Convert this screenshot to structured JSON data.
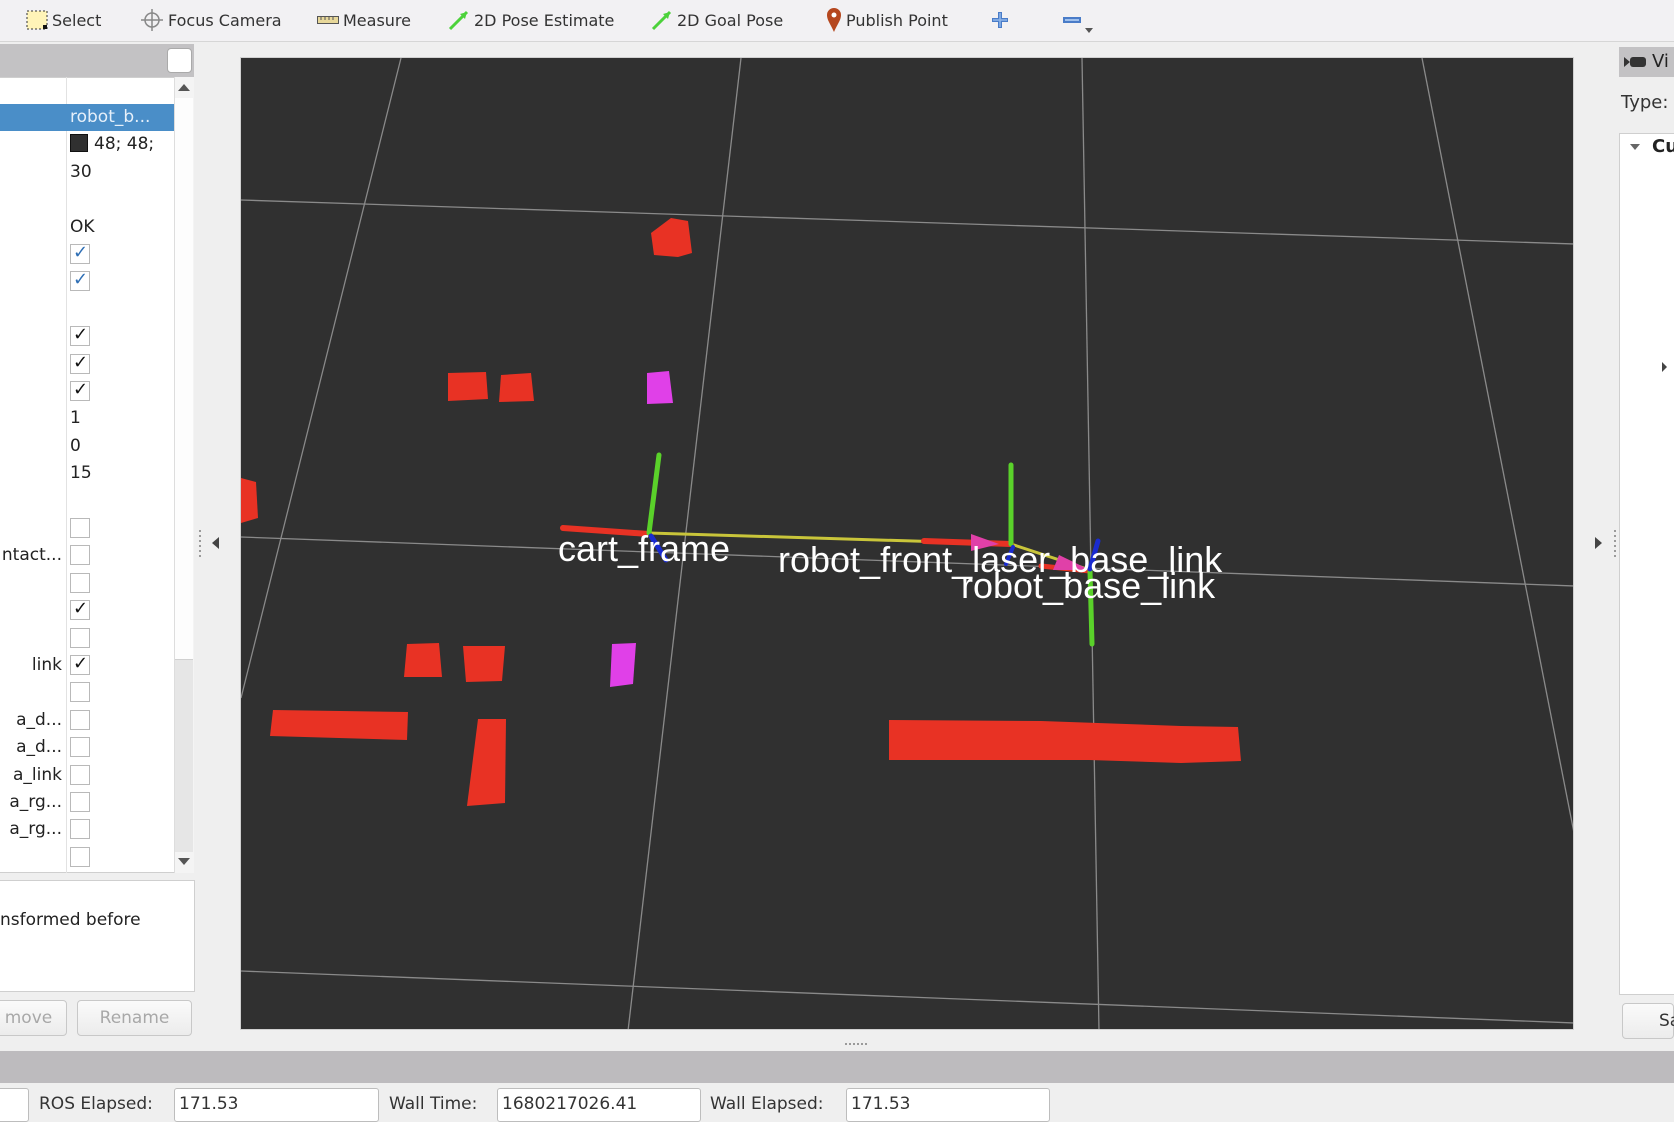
{
  "toolbar": {
    "tools": [
      {
        "id": "select",
        "label": "Select",
        "icon": "select-icon"
      },
      {
        "id": "focus-camera",
        "label": "Focus Camera",
        "icon": "crosshair-icon"
      },
      {
        "id": "measure",
        "label": "Measure",
        "icon": "ruler-icon"
      },
      {
        "id": "pose-estimate",
        "label": "2D Pose Estimate",
        "icon": "green-arrow-icon"
      },
      {
        "id": "goal-pose",
        "label": "2D Goal Pose",
        "icon": "green-arrow-icon"
      },
      {
        "id": "publish-point",
        "label": "Publish Point",
        "icon": "map-pin-icon"
      }
    ],
    "add_icon": "plus-icon",
    "remove_icon": "minus-icon"
  },
  "displays_panel": {
    "rows": [
      {
        "name": "",
        "value": "robot_b...",
        "type": "text",
        "selected": true
      },
      {
        "name": "",
        "value": "48; 48;",
        "type": "color",
        "color": "#303030"
      },
      {
        "name": "",
        "value": "30",
        "type": "text"
      },
      {
        "name": "",
        "value": "",
        "type": "blank"
      },
      {
        "name": "",
        "value": "OK",
        "type": "text"
      },
      {
        "name": "",
        "type": "checkbox",
        "checked": true,
        "style": "blue"
      },
      {
        "name": "",
        "type": "checkbox",
        "checked": true,
        "style": "blue"
      },
      {
        "name": "",
        "value": "",
        "type": "blank"
      },
      {
        "name": "",
        "type": "checkbox",
        "checked": true
      },
      {
        "name": "",
        "type": "checkbox",
        "checked": true
      },
      {
        "name": "",
        "type": "checkbox",
        "checked": true
      },
      {
        "name": "",
        "value": "1",
        "type": "text"
      },
      {
        "name": "",
        "value": "0",
        "type": "text"
      },
      {
        "name": "",
        "value": "15",
        "type": "text"
      },
      {
        "name": "",
        "value": "",
        "type": "blank"
      },
      {
        "name": "",
        "type": "checkbox",
        "checked": false
      },
      {
        "name": "ntact...",
        "type": "checkbox",
        "checked": false
      },
      {
        "name": "",
        "type": "checkbox",
        "checked": false
      },
      {
        "name": "",
        "type": "checkbox",
        "checked": true
      },
      {
        "name": "",
        "type": "checkbox",
        "checked": false
      },
      {
        "name": "link",
        "type": "checkbox",
        "checked": true
      },
      {
        "name": "",
        "type": "checkbox",
        "checked": false
      },
      {
        "name": "a_d...",
        "type": "checkbox",
        "checked": false
      },
      {
        "name": "a_d...",
        "type": "checkbox",
        "checked": false
      },
      {
        "name": "a_link",
        "type": "checkbox",
        "checked": false
      },
      {
        "name": "a_rg...",
        "type": "checkbox",
        "checked": false
      },
      {
        "name": "a_rg...",
        "type": "checkbox",
        "checked": false
      },
      {
        "name": "",
        "type": "checkbox",
        "checked": false
      }
    ],
    "description": "nsformed before",
    "remove_label": "move",
    "rename_label": "Rename"
  },
  "viewport": {
    "background": "#303030",
    "frames": [
      {
        "name": "cart_frame"
      },
      {
        "name": "robot_front_laser_base_link"
      },
      {
        "name": "robot_base_link"
      }
    ],
    "colors": {
      "obstacle": "#e83224",
      "highlight": "#e040e8",
      "x_axis": "#e83224",
      "y_axis": "#5ad22a",
      "z_axis": "#1a2bd0",
      "tf_link": "#c9c53a",
      "grid": "#a0a0a0"
    }
  },
  "views_panel": {
    "title": "Vi",
    "type_label": "Type:",
    "tree_root": "Cu",
    "save_label": "Sa"
  },
  "time_panel": {
    "ros_elapsed_label": "ROS Elapsed:",
    "ros_elapsed": "171.53",
    "wall_time_label": "Wall Time:",
    "wall_time": "1680217026.41",
    "wall_elapsed_label": "Wall Elapsed:",
    "wall_elapsed": "171.53"
  }
}
